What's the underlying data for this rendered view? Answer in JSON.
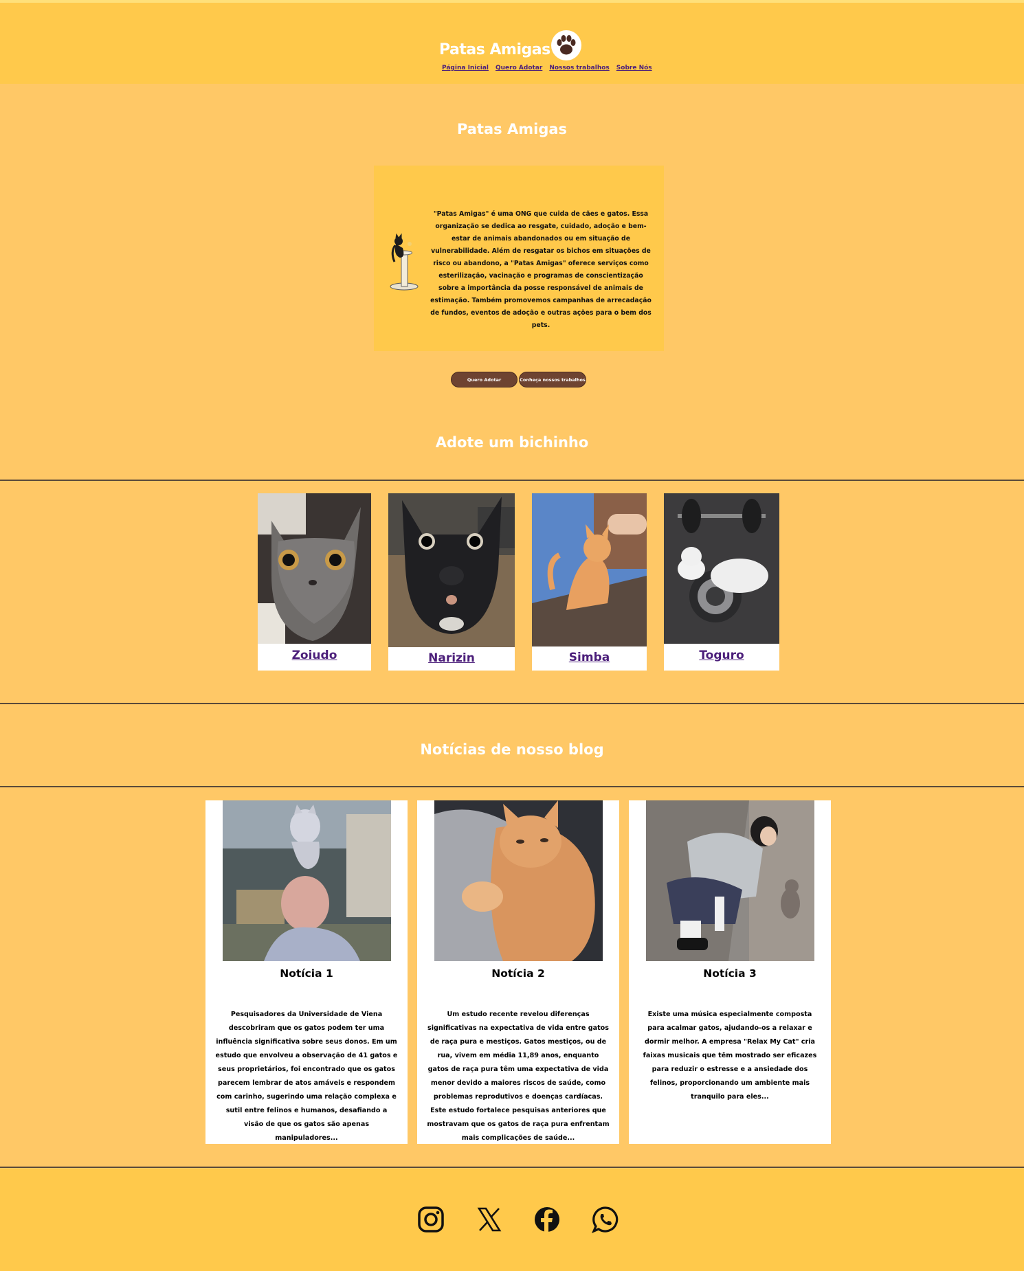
{
  "header": {
    "brand": "Patas Amigas",
    "logo_icon": "paw-icon",
    "nav": [
      "Página Inicial",
      "Quero Adotar",
      "Nossos trabalhos",
      "Sobre Nós"
    ]
  },
  "hero": {
    "title": "Patas Amigas",
    "illustration_icon": "cat-scratching-post-icon",
    "description": "\"Patas Amigas\" é uma ONG que cuida de cães e gatos. Essa organização se dedica ao resgate, cuidado, adoção e bem-estar de animais abandonados ou em situação de vulnerabilidade. Além de resgatar os bichos em situações de risco ou abandono, a \"Patas Amigas\" oferece serviços como esterilização, vacinação e programas de conscientização sobre a importância da posse responsável de animais de estimação. Também promovemos campanhas de arrecadação de fundos, eventos de adoção e outras ações para o bem dos pets.",
    "buttons": [
      "Quero Adotar",
      "Conheça nossos trabalhos"
    ]
  },
  "adopt": {
    "title": "Adote um bichinho",
    "pets": [
      {
        "name": "Zoiudo"
      },
      {
        "name": "Narizin"
      },
      {
        "name": "Simba"
      },
      {
        "name": "Toguro"
      }
    ]
  },
  "blog": {
    "title": "Notícias de nosso blog",
    "posts": [
      {
        "title": "Notícia 1",
        "text": "Pesquisadores da Universidade de Viena descobriram que os gatos podem ter uma influência significativa sobre seus donos. Em um estudo que envolveu a observação de 41 gatos e seus proprietários, foi encontrado que os gatos parecem lembrar de atos amáveis e respondem com carinho, sugerindo uma relação complexa e sutil entre felinos e humanos, desafiando a visão de que os gatos são apenas manipuladores..."
      },
      {
        "title": "Notícia 2",
        "text": "Um estudo recente revelou diferenças significativas na expectativa de vida entre gatos de raça pura e mestiços. Gatos mestiços, ou de rua, vivem em média 11,89 anos, enquanto gatos de raça pura têm uma expectativa de vida menor devido a maiores riscos de saúde, como problemas reprodutivos e doenças cardíacas. Este estudo fortalece pesquisas anteriores que mostravam que os gatos de raça pura enfrentam mais complicações de saúde..."
      },
      {
        "title": "Notícia 3",
        "text": "Existe uma música especialmente composta para acalmar gatos, ajudando-os a relaxar e dormir melhor. A empresa \"Relax My Cat\" cria faixas musicais que têm mostrado ser eficazes para reduzir o estresse e a ansiedade dos felinos, proporcionando um ambiente mais tranquilo para eles..."
      }
    ]
  },
  "footer": {
    "social_icons": [
      "instagram-icon",
      "x-icon",
      "facebook-icon",
      "whatsapp-icon"
    ]
  },
  "colors": {
    "page_bg": "#ffc866",
    "header_bg": "#ffc94b",
    "button_bg": "#6e4331",
    "link": "#4b1e7a",
    "title_text": "#ffffff"
  }
}
